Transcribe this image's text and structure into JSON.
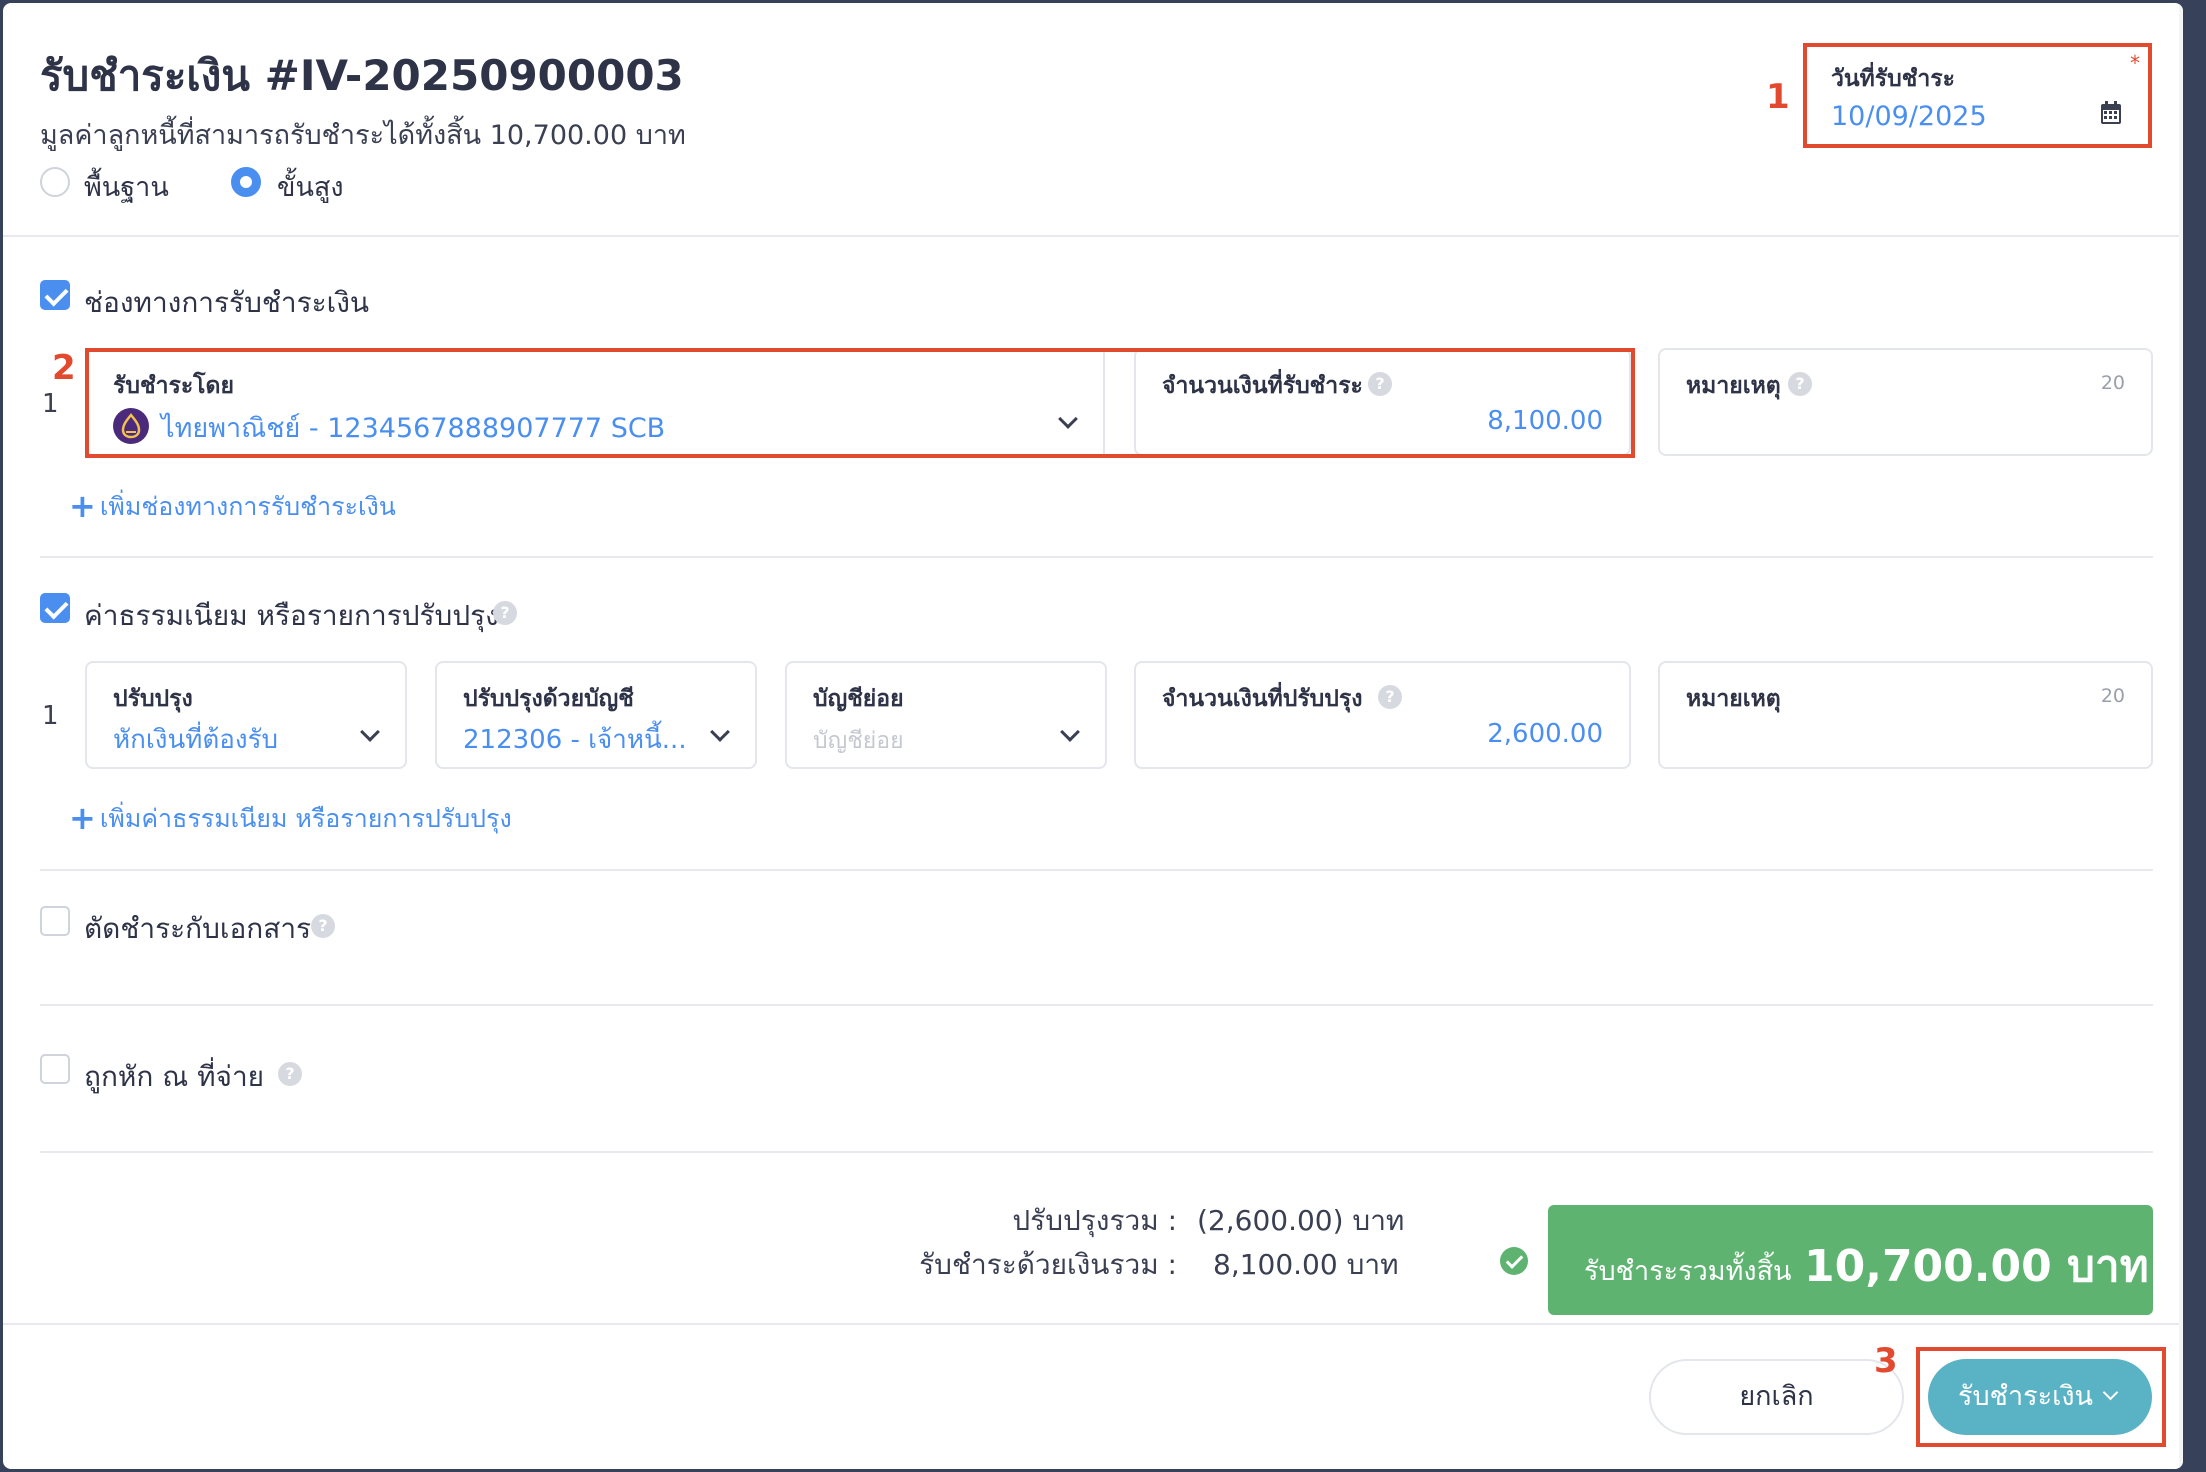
{
  "header": {
    "title": "รับชำระเงิน #IV-20250900003",
    "subtitle": "มูลค่าลูกหนี้ที่สามารถรับชำระได้ทั้งสิ้น 10,700.00 บาท",
    "mode_options": [
      {
        "label": "พื้นฐาน",
        "selected": false
      },
      {
        "label": "ขั้นสูง",
        "selected": true
      }
    ]
  },
  "payment_date": {
    "label": "วันที่รับชำระ",
    "required_mark": "*",
    "value": "10/09/2025",
    "icon": "calendar-icon"
  },
  "payment_channels": {
    "checkbox_label": "ช่องทางการรับชำระเงิน",
    "checked": true,
    "rows": [
      {
        "index": "1",
        "method_label": "รับชำระโดย",
        "method_value": "ไทยพาณิชย์ - 1234567888907777 SCB",
        "amount_label": "จำนวนเงินที่รับชำระ",
        "amount_value": "8,100.00",
        "note_label": "หมายเหตุ",
        "note_counter": "20"
      }
    ],
    "add_label": "เพิ่มช่องทางการรับชำระเงิน"
  },
  "adjustments": {
    "checkbox_label": "ค่าธรรมเนียม หรือรายการปรับปรุง",
    "checked": true,
    "rows": [
      {
        "index": "1",
        "type_label": "ปรับปรุง",
        "type_value": "หักเงินที่ต้องรับ",
        "account_label": "ปรับปรุงด้วยบัญชี",
        "account_value": "212306 - เจ้าหนี้...",
        "subaccount_label": "บัญชีย่อย",
        "subaccount_placeholder": "บัญชีย่อย",
        "amount_label": "จำนวนเงินที่ปรับปรุง",
        "amount_value": "2,600.00",
        "note_label": "หมายเหตุ",
        "note_counter": "20"
      }
    ],
    "add_label": "เพิ่มค่าธรรมเนียม หรือรายการปรับปรุง"
  },
  "offset_documents": {
    "checkbox_label": "ตัดชำระกับเอกสาร",
    "checked": false
  },
  "withholding": {
    "checkbox_label": "ถูกหัก ณ ที่จ่าย",
    "checked": false
  },
  "summary": {
    "adjust_total_label": "ปรับปรุงรวม :",
    "adjust_total_value": "(2,600.00) บาท",
    "cash_total_label": "รับชำระด้วยเงินรวม :",
    "cash_total_value": "8,100.00 บาท",
    "grand_total_label": "รับชำระรวมทั้งสิ้น",
    "grand_total_value": "10,700.00 บาท"
  },
  "footer": {
    "cancel_label": "ยกเลิก",
    "submit_label": "รับชำระเงิน"
  },
  "annotations": [
    "1",
    "2",
    "3"
  ],
  "colors": {
    "accent": "#4a8ff0",
    "success": "#5db36f",
    "submit": "#5ab3c4",
    "highlight": "#e24a2f"
  }
}
